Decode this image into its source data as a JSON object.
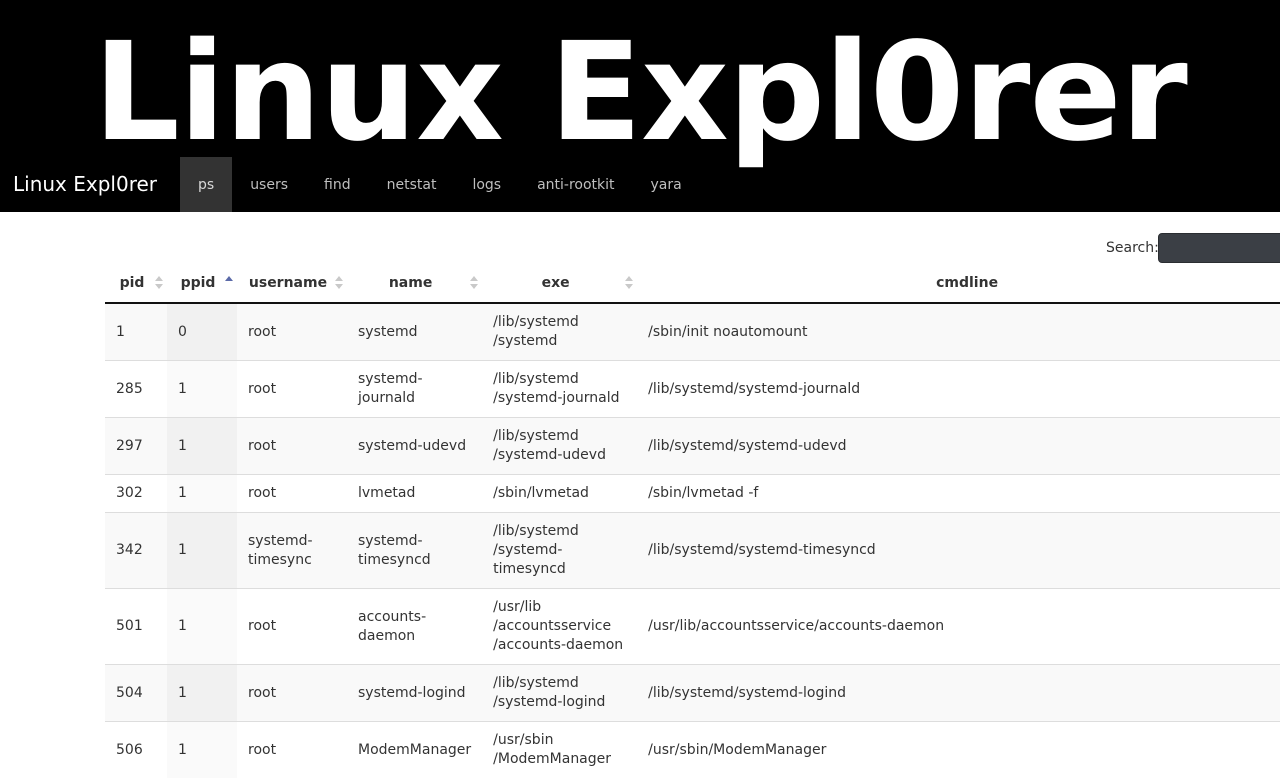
{
  "banner": {
    "title": "Linux Expl0rer"
  },
  "navbar": {
    "brand": "Linux Expl0rer",
    "tabs": [
      {
        "label": "ps",
        "active": true
      },
      {
        "label": "users",
        "active": false
      },
      {
        "label": "find",
        "active": false
      },
      {
        "label": "netstat",
        "active": false
      },
      {
        "label": "logs",
        "active": false
      },
      {
        "label": "anti-rootkit",
        "active": false
      },
      {
        "label": "yara",
        "active": false
      }
    ]
  },
  "search": {
    "label": "Search:",
    "value": ""
  },
  "table": {
    "columns": [
      "pid",
      "ppid",
      "username",
      "name",
      "exe",
      "cmdline"
    ],
    "sorted_column": "ppid",
    "sort_direction": "ascending",
    "rows": [
      {
        "pid": "1",
        "ppid": "0",
        "username": "root",
        "name": "systemd",
        "exe": "/lib/systemd\n/systemd",
        "cmdline": "/sbin/init noautomount"
      },
      {
        "pid": "285",
        "ppid": "1",
        "username": "root",
        "name": "systemd-journald",
        "exe": "/lib/systemd\n/systemd-journald",
        "cmdline": "/lib/systemd/systemd-journald"
      },
      {
        "pid": "297",
        "ppid": "1",
        "username": "root",
        "name": "systemd-udevd",
        "exe": "/lib/systemd\n/systemd-udevd",
        "cmdline": "/lib/systemd/systemd-udevd"
      },
      {
        "pid": "302",
        "ppid": "1",
        "username": "root",
        "name": "lvmetad",
        "exe": "/sbin/lvmetad",
        "cmdline": "/sbin/lvmetad -f"
      },
      {
        "pid": "342",
        "ppid": "1",
        "username": "systemd-\ntimesync",
        "name": "systemd-\ntimesyncd",
        "exe": "/lib/systemd\n/systemd-timesyncd",
        "cmdline": "/lib/systemd/systemd-timesyncd"
      },
      {
        "pid": "501",
        "ppid": "1",
        "username": "root",
        "name": "accounts-\ndaemon",
        "exe": "/usr/lib\n/accountsservice\n/accounts-daemon",
        "cmdline": "/usr/lib/accountsservice/accounts-daemon"
      },
      {
        "pid": "504",
        "ppid": "1",
        "username": "root",
        "name": "systemd-logind",
        "exe": "/lib/systemd\n/systemd-logind",
        "cmdline": "/lib/systemd/systemd-logind"
      },
      {
        "pid": "506",
        "ppid": "1",
        "username": "root",
        "name": "ModemManager",
        "exe": "/usr/sbin\n/ModemManager",
        "cmdline": "/usr/sbin/ModemManager"
      }
    ]
  }
}
